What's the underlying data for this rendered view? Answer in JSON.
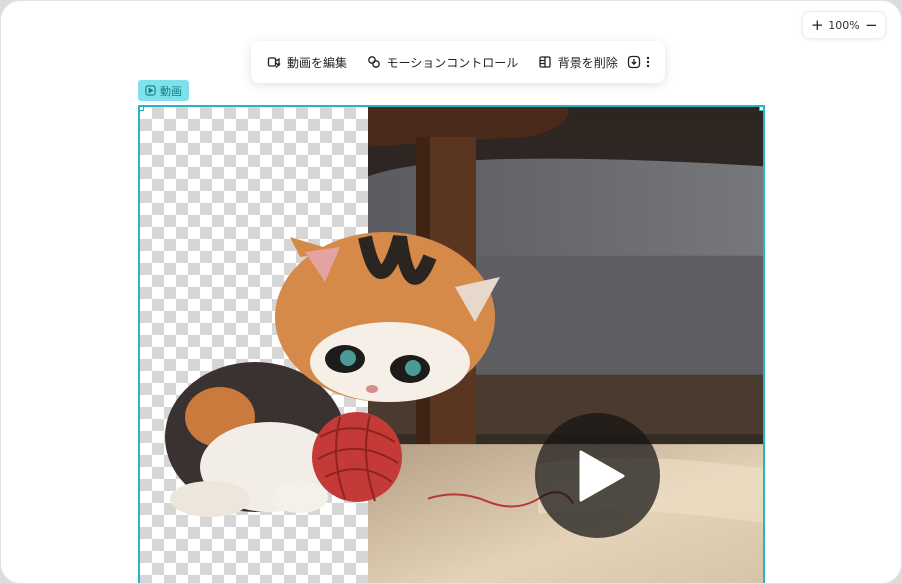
{
  "zoom": {
    "zoom_in": "+",
    "level": "100%",
    "zoom_out": "−"
  },
  "toolbar": {
    "edit_video": "動画を編集",
    "motion_control": "モーションコントロール",
    "remove_background": "背景を削除"
  },
  "selection": {
    "tag_label": "動画"
  },
  "colors": {
    "accent": "#27b4c4",
    "tag_bg": "#7fe1ea",
    "tag_text": "#137f88"
  }
}
